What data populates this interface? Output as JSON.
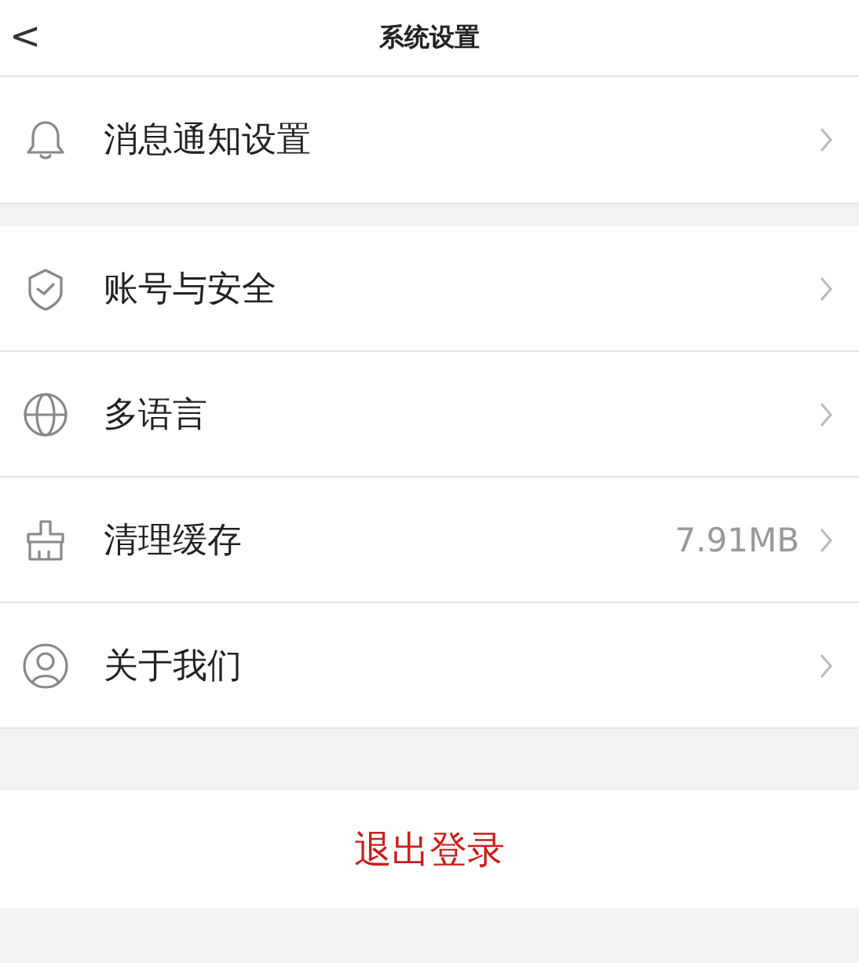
{
  "header": {
    "back": "<",
    "title": "系统设置"
  },
  "groups": [
    {
      "items": [
        {
          "kind": "bell",
          "label": "消息通知设置"
        }
      ]
    },
    {
      "items": [
        {
          "kind": "shield",
          "label": "账号与安全"
        },
        {
          "kind": "globe",
          "label": "多语言"
        },
        {
          "kind": "brush",
          "label": "清理缓存",
          "value": "7.91MB"
        },
        {
          "kind": "user",
          "label": "关于我们"
        }
      ]
    }
  ],
  "logout": "退出登录"
}
